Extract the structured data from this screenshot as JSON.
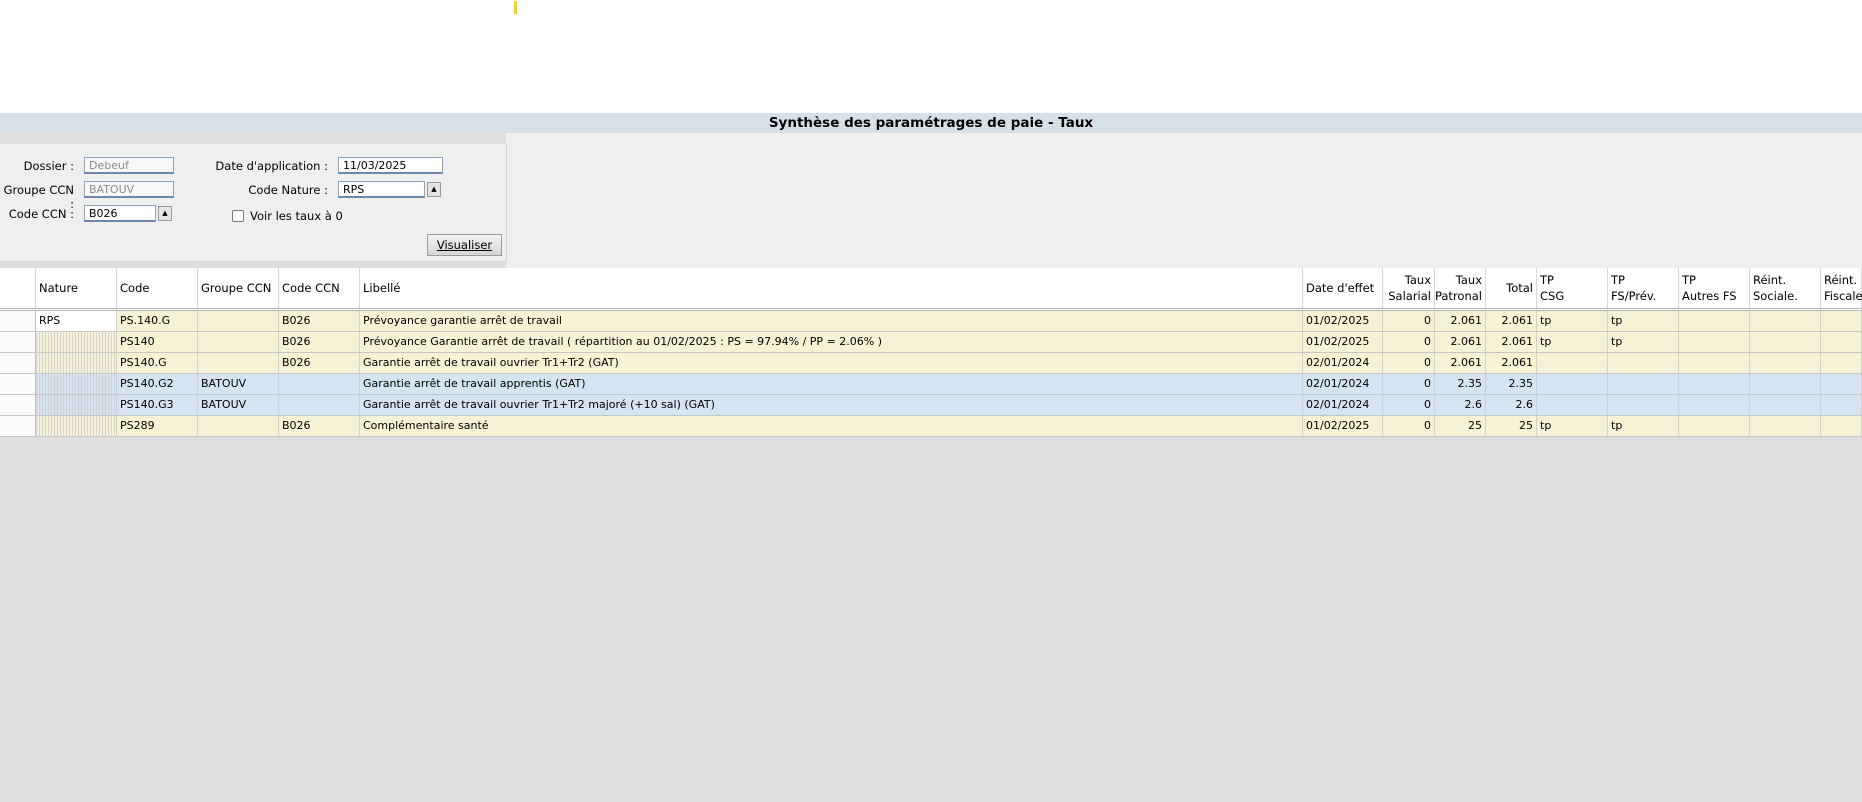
{
  "title": "Synthèse des paramétrages de paie - Taux",
  "filters": {
    "dossier_label": "Dossier :",
    "dossier_value": "Debeuf",
    "groupe_ccn_label": "Groupe CCN :",
    "groupe_ccn_value": "BATOUV",
    "code_ccn_label": "Code CCN :",
    "code_ccn_value": "B026",
    "date_application_label": "Date d'application :",
    "date_application_value": "11/03/2025",
    "code_nature_label": "Code Nature :",
    "code_nature_value": "RPS",
    "voir_taux_label": "Voir les taux à 0",
    "voir_taux_checked": false,
    "visualiser_label": "Visualiser"
  },
  "table": {
    "columns": [
      {
        "key": "nature",
        "line1": "Nature",
        "line2": ""
      },
      {
        "key": "code",
        "line1": "Code",
        "line2": ""
      },
      {
        "key": "groupe",
        "line1": "Groupe CCN",
        "line2": ""
      },
      {
        "key": "ccn",
        "line1": "Code CCN",
        "line2": ""
      },
      {
        "key": "libelle",
        "line1": "Libellé",
        "line2": ""
      },
      {
        "key": "date",
        "line1": "Date d'effet",
        "line2": ""
      },
      {
        "key": "sal",
        "line1": "Taux",
        "line2": "Salarial"
      },
      {
        "key": "pat",
        "line1": "Taux",
        "line2": "Patronal"
      },
      {
        "key": "total",
        "line1": "Total",
        "line2": ""
      },
      {
        "key": "csg",
        "line1": "TP",
        "line2": "CSG"
      },
      {
        "key": "fs",
        "line1": "TP",
        "line2": "FS/Prév."
      },
      {
        "key": "autres",
        "line1": "TP",
        "line2": "Autres FS"
      },
      {
        "key": "rsoc",
        "line1": "Réint.",
        "line2": "Sociale."
      },
      {
        "key": "rfis",
        "line1": "Réint.",
        "line2": "Fiscale"
      }
    ],
    "rows": [
      {
        "style": "y",
        "nature": "RPS",
        "code": "PS.140.G",
        "groupe": "",
        "ccn": "B026",
        "libelle": "Prévoyance garantie arrêt de travail",
        "date": "01/02/2025",
        "sal": "0",
        "pat": "2.061",
        "total": "2.061",
        "csg": "tp",
        "fs": "tp",
        "autres": "",
        "rsoc": "",
        "rfis": ""
      },
      {
        "style": "y",
        "nature": "",
        "code": "PS140",
        "groupe": "",
        "ccn": "B026",
        "libelle": "Prévoyance Garantie arrêt de travail  ( répartition au 01/02/2025 : PS = 97.94% / PP = 2.06% )",
        "date": "01/02/2025",
        "sal": "0",
        "pat": "2.061",
        "total": "2.061",
        "csg": "tp",
        "fs": "tp",
        "autres": "",
        "rsoc": "",
        "rfis": ""
      },
      {
        "style": "y",
        "nature": "",
        "code": "PS140.G",
        "groupe": "",
        "ccn": "B026",
        "libelle": "Garantie arrêt de travail ouvrier Tr1+Tr2 (GAT)",
        "date": "02/01/2024",
        "sal": "0",
        "pat": "2.061",
        "total": "2.061",
        "csg": "",
        "fs": "",
        "autres": "",
        "rsoc": "",
        "rfis": ""
      },
      {
        "style": "b",
        "nature": "",
        "code": "PS140.G2",
        "groupe": "BATOUV",
        "ccn": "",
        "libelle": "Garantie arrêt de travail apprentis (GAT)",
        "date": "02/01/2024",
        "sal": "0",
        "pat": "2.35",
        "total": "2.35",
        "csg": "",
        "fs": "",
        "autres": "",
        "rsoc": "",
        "rfis": ""
      },
      {
        "style": "b",
        "nature": "",
        "code": "PS140.G3",
        "groupe": "BATOUV",
        "ccn": "",
        "libelle": "Garantie arrêt de travail ouvrier Tr1+Tr2  majoré (+10 sal) (GAT)",
        "date": "02/01/2024",
        "sal": "0",
        "pat": "2.6",
        "total": "2.6",
        "csg": "",
        "fs": "",
        "autres": "",
        "rsoc": "",
        "rfis": ""
      },
      {
        "style": "y",
        "nature": "",
        "code": "PS289",
        "groupe": "",
        "ccn": "B026",
        "libelle": "Complémentaire santé",
        "date": "01/02/2025",
        "sal": "0",
        "pat": "25",
        "total": "25",
        "csg": "tp",
        "fs": "tp",
        "autres": "",
        "rsoc": "",
        "rfis": ""
      }
    ]
  }
}
